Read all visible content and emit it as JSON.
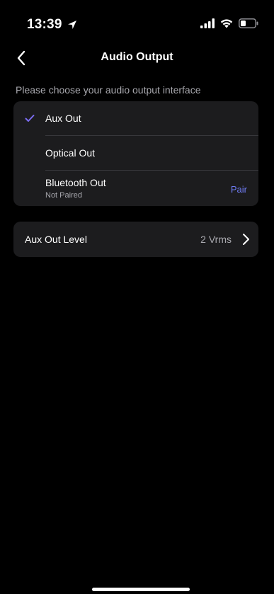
{
  "status_bar": {
    "time": "13:39",
    "icons": [
      "location-arrow-icon",
      "signal-icon",
      "wifi-icon",
      "battery-icon"
    ]
  },
  "nav": {
    "back_icon": "chevron-left-icon",
    "title": "Audio Output"
  },
  "output": {
    "caption": "Please choose your audio output interface",
    "options": [
      {
        "label": "Aux Out",
        "selected": true
      },
      {
        "label": "Optical Out",
        "selected": false
      },
      {
        "label": "Bluetooth Out",
        "subtitle": "Not Paired",
        "action": "Pair",
        "selected": false
      }
    ]
  },
  "level": {
    "label": "Aux Out Level",
    "value": "2 Vrms",
    "chevron_icon": "chevron-right-icon"
  },
  "colors": {
    "background": "#000000",
    "card": "#1c1c1e",
    "accent": "#6f7cf3",
    "check": "#7b6cf0",
    "secondary_text": "#a8a8ae"
  }
}
